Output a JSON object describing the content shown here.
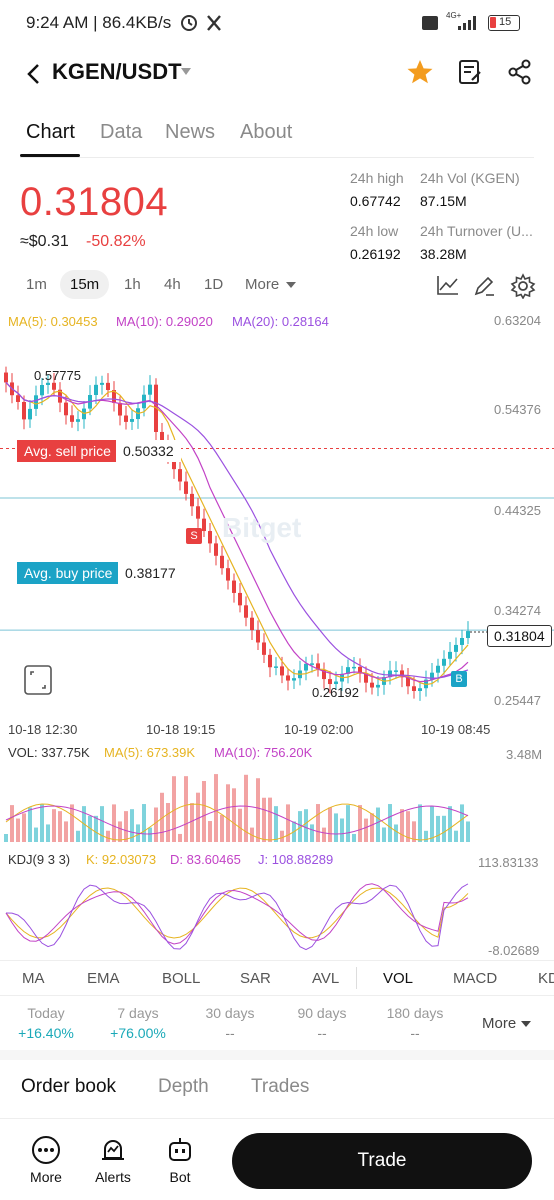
{
  "status": {
    "time": "9:24 AM | 86.4KB/s",
    "network": "4G+",
    "battery": "15"
  },
  "header": {
    "pair": "KGEN/USDT"
  },
  "tabs": [
    "Chart",
    "Data",
    "News",
    "About"
  ],
  "price": {
    "last": "0.31804",
    "usd": "≈$0.31",
    "change": "-50.82%"
  },
  "stats": {
    "high_label": "24h high",
    "high": "0.67742",
    "vol_label": "24h Vol (KGEN)",
    "vol": "87.15M",
    "low_label": "24h low",
    "low": "0.26192",
    "turnover_label": "24h Turnover (U...",
    "turnover": "38.28M"
  },
  "intervals": [
    "1m",
    "15m",
    "1h",
    "4h",
    "1D",
    "More"
  ],
  "ma_legend": {
    "ma5": "MA(5): 0.30453",
    "ma10": "MA(10): 0.29020",
    "ma20": "MA(20): 0.28164"
  },
  "price_axis": [
    "0.63204",
    "0.54376",
    "0.44325",
    "0.34274",
    "0.25447"
  ],
  "markers": {
    "high": "0.57775",
    "low": "0.26192",
    "current": "0.31804",
    "avg_sell_label": "Avg. sell price",
    "avg_sell": "0.50332",
    "avg_buy_label": "Avg. buy price",
    "avg_buy": "0.38177",
    "sell_tag": "S",
    "buy_tag": "B"
  },
  "time_axis": [
    "10-18 12:30",
    "10-18 19:15",
    "10-19 02:00",
    "10-19 08:45"
  ],
  "vol_legend": {
    "vol": "VOL: 337.75K",
    "ma5": "MA(5): 673.39K",
    "ma10": "MA(10): 756.20K",
    "max": "3.48M"
  },
  "kdj_legend": {
    "name": "KDJ(9 3 3)",
    "k": "K: 92.03073",
    "d": "D: 83.60465",
    "j": "J: 108.88289",
    "max": "113.83133",
    "min": "-8.02689"
  },
  "indicators": [
    "MA",
    "EMA",
    "BOLL",
    "SAR",
    "AVL",
    "VOL",
    "MACD",
    "KD"
  ],
  "performance": [
    {
      "label": "Today",
      "value": "+16.40%"
    },
    {
      "label": "7 days",
      "value": "+76.00%"
    },
    {
      "label": "30 days",
      "value": "--"
    },
    {
      "label": "90 days",
      "value": "--"
    },
    {
      "label": "180 days",
      "value": "--"
    }
  ],
  "perf_more": "More",
  "book_tabs": [
    "Order book",
    "Depth",
    "Trades"
  ],
  "bottom_nav": {
    "more": "More",
    "alerts": "Alerts",
    "bot": "Bot",
    "trade": "Trade"
  },
  "watermark": "Bitget",
  "colors": {
    "up": "#26b5c4",
    "down": "#e84040",
    "ma5": "#e6b422",
    "ma10": "#c242c6",
    "ma20": "#9b51e0",
    "star": "#f39c1f"
  }
}
